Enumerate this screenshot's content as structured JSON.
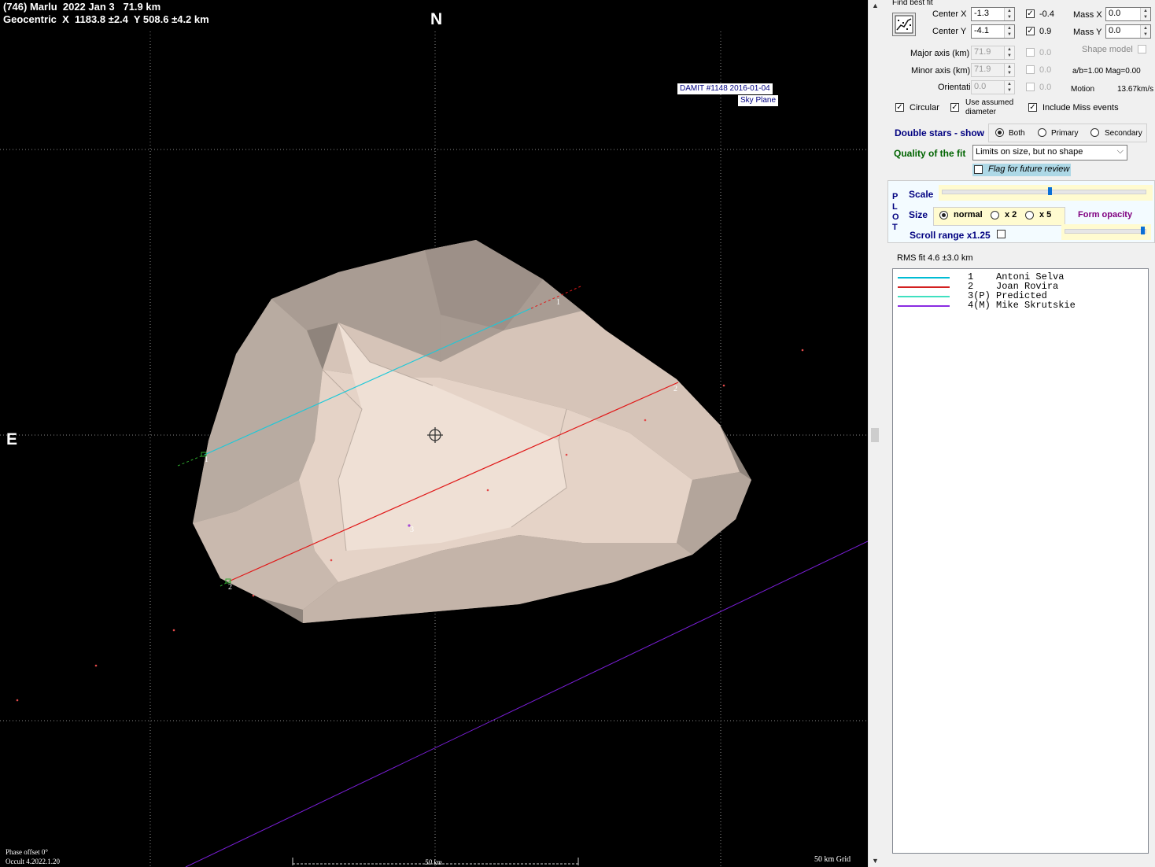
{
  "plot": {
    "title_line1": "(746) Marlu  2022 Jan 3   71.9 km",
    "title_line2": "Geocentric  X  1183.8 ±2.4  Y 508.6 ±4.2 km",
    "north_label": "N",
    "east_label": "E",
    "damit_label": "DAMIT #1148 2016-01-04",
    "plane_label": "Sky Plane",
    "phase_offset": "Phase offset 0°",
    "version": "Occult 4.2022.1.20",
    "scale_label": "50 km",
    "grid_label": "50 km Grid",
    "chord_labels": [
      "1",
      "1",
      "2",
      "2",
      "3"
    ]
  },
  "panel": {
    "find_best_fit_label": "Find best fit",
    "center_x_label": "Center X",
    "center_x_value": "-1.3",
    "center_x_check_value": "-0.4",
    "center_y_label": "Center Y",
    "center_y_value": "-4.1",
    "center_y_check_value": "0.9",
    "mass_x_label": "Mass X",
    "mass_x_value": "0.0",
    "mass_y_label": "Mass Y",
    "mass_y_value": "0.0",
    "major_axis_label": "Major axis (km)",
    "major_axis_value": "71.9",
    "major_axis_check_value": "0.0",
    "minor_axis_label": "Minor axis (km)",
    "minor_axis_value": "71.9",
    "minor_axis_check_value": "0.0",
    "orientation_label": "Orientation",
    "orientation_value": "0.0",
    "orientation_check_value": "0.0",
    "shape_model_label": "Shape model",
    "ab_mag_label": "a/b=1.00  Mag=0.00",
    "motion_label": "Motion",
    "motion_value": "13.67km/s",
    "circular_label": "Circular",
    "use_assumed_label": "Use assumed diameter",
    "include_miss_label": "Include Miss events",
    "double_stars_label": "Double stars - show",
    "ds_both": "Both",
    "ds_primary": "Primary",
    "ds_secondary": "Secondary",
    "quality_label": "Quality of the fit",
    "quality_value": "Limits on size, but no shape",
    "flag_label": "Flag for future review",
    "plot_vertical": "PLOT",
    "scale_slider_label": "Scale",
    "size_label": "Size",
    "size_normal": "normal",
    "size_x2": "x 2",
    "size_x5": "x 5",
    "form_opacity_label": "Form opacity",
    "scroll_range_label": "Scroll range x1.25",
    "rms_label": "RMS fit 4.6 ±3.0 km",
    "scale_level": 0.53,
    "opacity_level": 1.0
  },
  "legend": [
    {
      "num": "1",
      "tag": "   ",
      "name": "Antoni Selva",
      "color": "#00bcd4"
    },
    {
      "num": "2",
      "tag": "   ",
      "name": "Joan Rovira",
      "color": "#d32020"
    },
    {
      "num": "3",
      "tag": "(P)",
      "name": "Predicted",
      "color": "#40e0c0"
    },
    {
      "num": "4",
      "tag": "(M)",
      "name": "Mike Skrutskie",
      "color": "#8a2be2"
    }
  ],
  "colors": {
    "chord1": "#1ec8d8",
    "chord2": "#e01818",
    "miss": "#7a1ed8",
    "asteroid_light": "#e6d2c6",
    "asteroid_dark": "#8c8179",
    "section_title": "#000080",
    "quality_title": "#006400",
    "form_opacity": "#800080"
  }
}
